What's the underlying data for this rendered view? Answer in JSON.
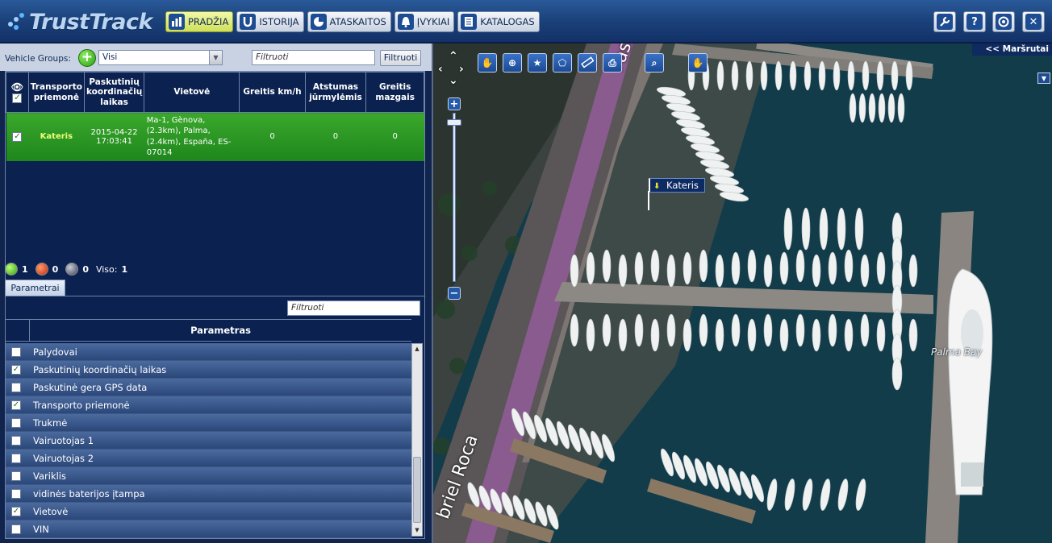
{
  "app": {
    "title": "TrustTrack"
  },
  "nav": [
    {
      "label": "PRADŽIA",
      "icon": "bar-chart-icon",
      "active": true
    },
    {
      "label": "ISTORIJA",
      "icon": "history-magnet-icon",
      "active": false
    },
    {
      "label": "ATASKAITOS",
      "icon": "pie-chart-icon",
      "active": false
    },
    {
      "label": "ĮVYKIAI",
      "icon": "alarm-bell-icon",
      "active": false
    },
    {
      "label": "KATALOGAS",
      "icon": "catalog-document-icon",
      "active": false
    }
  ],
  "toolbar": {
    "settings_icon": "wrench-icon",
    "help_icon": "help-icon",
    "support_icon": "lifebuoy-icon",
    "close_icon": "close-icon",
    "help_glyph": "?",
    "close_glyph": "✕"
  },
  "vehicle_groups": {
    "label": "Vehicle Groups:",
    "selected": "Visi",
    "filter_placeholder": "Filtruoti",
    "filter_button": "Filtruoti"
  },
  "vehicle_table": {
    "headers": [
      "Transporto priemonė",
      "Paskutinių koordinačių laikas",
      "Vietovė",
      "Greitis km/h",
      "Atstumas jūrmylėmis",
      "Greitis mazgais"
    ],
    "rows": [
      {
        "checked": true,
        "name": "Kateris",
        "time": "2015-04-22 17:03:41",
        "location": "Ma-1, Gènova, (2.3km), Palma, (2.4km), España, ES-07014",
        "speed_kmh": "0",
        "distance_nm": "0",
        "speed_knots": "0"
      }
    ]
  },
  "status": {
    "green": "1",
    "red": "0",
    "grey": "0",
    "total_label": "Viso:",
    "total": "1"
  },
  "params": {
    "tab": "Parametrai",
    "filter_placeholder": "Filtruoti",
    "header": "Parametras",
    "items": [
      {
        "label": "Palydovai",
        "checked": false
      },
      {
        "label": "Paskutinių koordinačių laikas",
        "checked": true
      },
      {
        "label": "Paskutinė gera GPS data",
        "checked": false
      },
      {
        "label": "Transporto priemonė",
        "checked": true
      },
      {
        "label": "Trukmė",
        "checked": false
      },
      {
        "label": "Vairuotojas 1",
        "checked": false
      },
      {
        "label": "Vairuotojas 2",
        "checked": false
      },
      {
        "label": "Variklis",
        "checked": false
      },
      {
        "label": "vidinės baterijos įtampa",
        "checked": false
      },
      {
        "label": "Vietovė",
        "checked": true
      },
      {
        "label": "VIN",
        "checked": false
      }
    ]
  },
  "map": {
    "route_button": "<< Maršrutai",
    "vehicle_label": "Kateris",
    "street_1": "Passeig",
    "street_2": "briel Roca",
    "place_label": "Palma Bay",
    "tools": [
      "hand-icon",
      "zoom-in-icon",
      "star-icon",
      "polygon-icon",
      "ruler-icon",
      "print-icon",
      "search-icon",
      "hand-icon"
    ]
  },
  "colors": {
    "active_row": "#2a9a24",
    "header_bg": "#1c437c",
    "nav_active": "#dfe87a",
    "panel_bg": "#0b2150"
  }
}
